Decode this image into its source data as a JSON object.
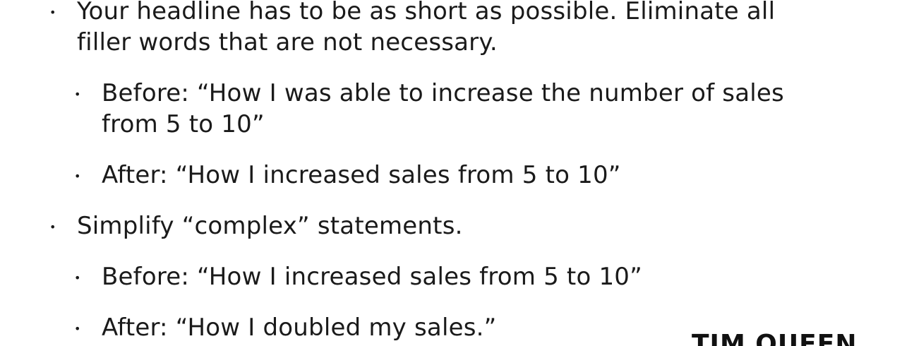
{
  "bullets": {
    "b1": {
      "line1": "Your headline has to be as short as possible. Eliminate all",
      "line2": "filler words that are not necessary.",
      "sub1": {
        "line1": "Before: “How I was able to increase the number of sales",
        "line2": "from 5 to 10”"
      },
      "sub2": {
        "line1": "After: “How I increased sales from 5 to 10”"
      }
    },
    "b2": {
      "line1": "Simplify “complex” statements.",
      "sub1": {
        "line1": "Before: “How I increased sales from 5 to 10”"
      },
      "sub2": {
        "line1": "After: “How I doubled my sales.”"
      }
    }
  },
  "bullet_glyph": "•",
  "brand": "TIM QUEEN"
}
